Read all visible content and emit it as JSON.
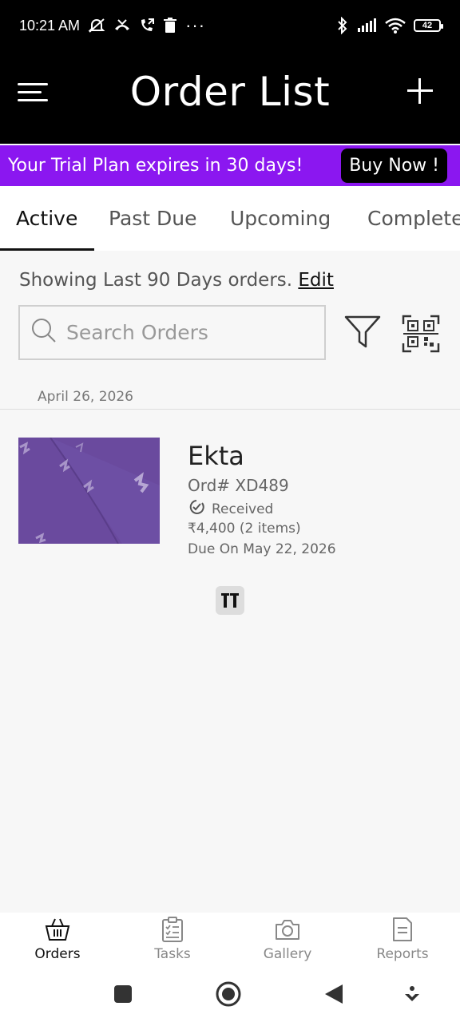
{
  "status_bar": {
    "time": "10:21 AM",
    "dots": "···",
    "battery": "42"
  },
  "app_bar": {
    "title": "Order List"
  },
  "trial_banner": {
    "text": "Your Trial Plan expires in 30 days!",
    "button_label": "Buy Now !"
  },
  "tabs": [
    {
      "label": "Active",
      "active": true
    },
    {
      "label": "Past Due",
      "active": false
    },
    {
      "label": "Upcoming",
      "active": false
    },
    {
      "label": "Completed",
      "active": false
    }
  ],
  "filter_info": {
    "text": "Showing Last 90 Days orders.",
    "edit_label": "Edit"
  },
  "search": {
    "placeholder": "Search Orders",
    "value": ""
  },
  "orders_group": {
    "date": "April 26, 2026"
  },
  "order": {
    "customer": "Ekta",
    "order_no": "Ord#  XD489",
    "status": "Received",
    "amount": "₹4,400 (2 items)",
    "due": "Due On May 22, 2026"
  },
  "bottom_nav": [
    {
      "label": "Orders",
      "icon": "basket-icon",
      "active": true
    },
    {
      "label": "Tasks",
      "icon": "clipboard-icon",
      "active": false
    },
    {
      "label": "Gallery",
      "icon": "camera-icon",
      "active": false
    },
    {
      "label": "Reports",
      "icon": "document-icon",
      "active": false
    }
  ],
  "colors": {
    "banner": "#8b17f0",
    "header": "#000000",
    "background": "#f7f7f7"
  }
}
